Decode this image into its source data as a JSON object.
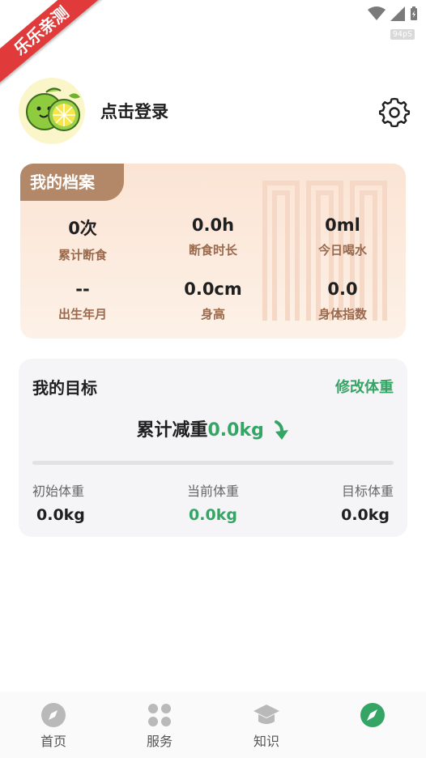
{
  "status": {
    "fps": "94pS",
    "badge": "乐乐亲测"
  },
  "header": {
    "login_text": "点击登录"
  },
  "profile": {
    "tab_label": "我的档案",
    "stats": [
      {
        "value": "0次",
        "label": "累计断食"
      },
      {
        "value": "0.0h",
        "label": "断食时长"
      },
      {
        "value": "0ml",
        "label": "今日喝水"
      },
      {
        "value": "--",
        "label": "出生年月"
      },
      {
        "value": "0.0cm",
        "label": "身高"
      },
      {
        "value": "0.0",
        "label": "身体指数"
      }
    ]
  },
  "goal": {
    "title": "我的目标",
    "edit_label": "修改体重",
    "total_label": "累计减重",
    "total_value": "0.0kg",
    "progress": 0,
    "initial": {
      "label": "初始体重",
      "value": "0.0kg"
    },
    "current": {
      "label": "当前体重",
      "value": "0.0kg"
    },
    "target": {
      "label": "目标体重",
      "value": "0.0kg"
    }
  },
  "nav": [
    {
      "label": "首页",
      "icon": "compass-icon"
    },
    {
      "label": "服务",
      "icon": "grid-icon"
    },
    {
      "label": "知识",
      "icon": "graduation-cap-icon"
    },
    {
      "label": "",
      "icon": "compass-active-icon"
    }
  ],
  "colors": {
    "accent": "#35a565",
    "profile_tab": "#b28868",
    "ribbon": "#e03a3a"
  }
}
